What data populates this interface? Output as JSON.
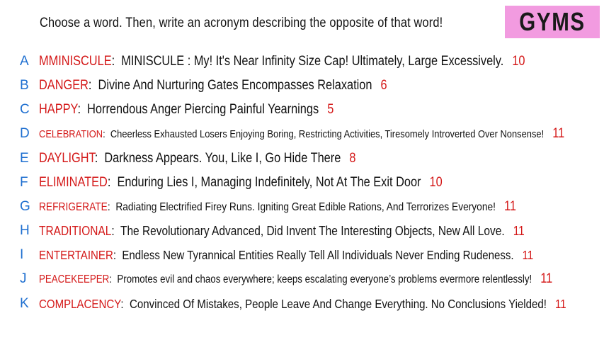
{
  "header": {
    "prompt": "Choose a word. Then, write an acronym describing the opposite of that word!",
    "badge": "GYMS"
  },
  "items": [
    {
      "letter": "A",
      "word": "MMINISCULE",
      "acronym": "MINISCULE : My! It's Near Infinity Size Cap! Ultimately, Large Excessively.",
      "score": "10"
    },
    {
      "letter": "B",
      "word": "DANGER",
      "acronym": "Divine And Nurturing Gates Encompasses Relaxation",
      "score": "6"
    },
    {
      "letter": "C",
      "word": "HAPPY",
      "acronym": "Horrendous Anger Piercing Painful Yearnings",
      "score": "5"
    },
    {
      "letter": "D",
      "word": "CELEBRATION",
      "acronym": "Cheerless Exhausted Losers Enjoying Boring, Restricting Activities, Tiresomely Introverted Over Nonsense!",
      "score": "11"
    },
    {
      "letter": "E",
      "word": "DAYLIGHT",
      "acronym": "Darkness Appears. You, Like I, Go Hide There",
      "score": "8"
    },
    {
      "letter": "F",
      "word": "ELIMINATED",
      "acronym": "Enduring Lies I, Managing Indefinitely, Not At The Exit Door",
      "score": "10"
    },
    {
      "letter": "G",
      "word": "REFRIGERATE",
      "acronym": "Radiating Electrified Firey Runs. Igniting Great Edible Rations, And Terrorizes Everyone!",
      "score": "11"
    },
    {
      "letter": "H",
      "word": "TRADITIONAL",
      "acronym": "The Revolutionary Advanced, Did Invent The Interesting Objects, New All Love.",
      "score": "11"
    },
    {
      "letter": "I",
      "word": "ENTERTAINER",
      "acronym": "Endless New Tyrannical Entities Really Tell All Individuals Never Ending Rudeness.",
      "score": "11"
    },
    {
      "letter": "J",
      "word": "PEACEKEEPER",
      "acronym": "Promotes evil and chaos everywhere; keeps escalating everyone’s problems evermore relentlessly!",
      "score": "11"
    },
    {
      "letter": "K",
      "word": "COMPLACENCY",
      "acronym": "Convinced Of Mistakes, People Leave And Change Everything. No Conclusions Yielded!",
      "score": "11"
    }
  ],
  "colors": {
    "letter": "#1e6fd0",
    "word": "#d41818",
    "score": "#d41818",
    "badge_bg": "#f29be0"
  }
}
